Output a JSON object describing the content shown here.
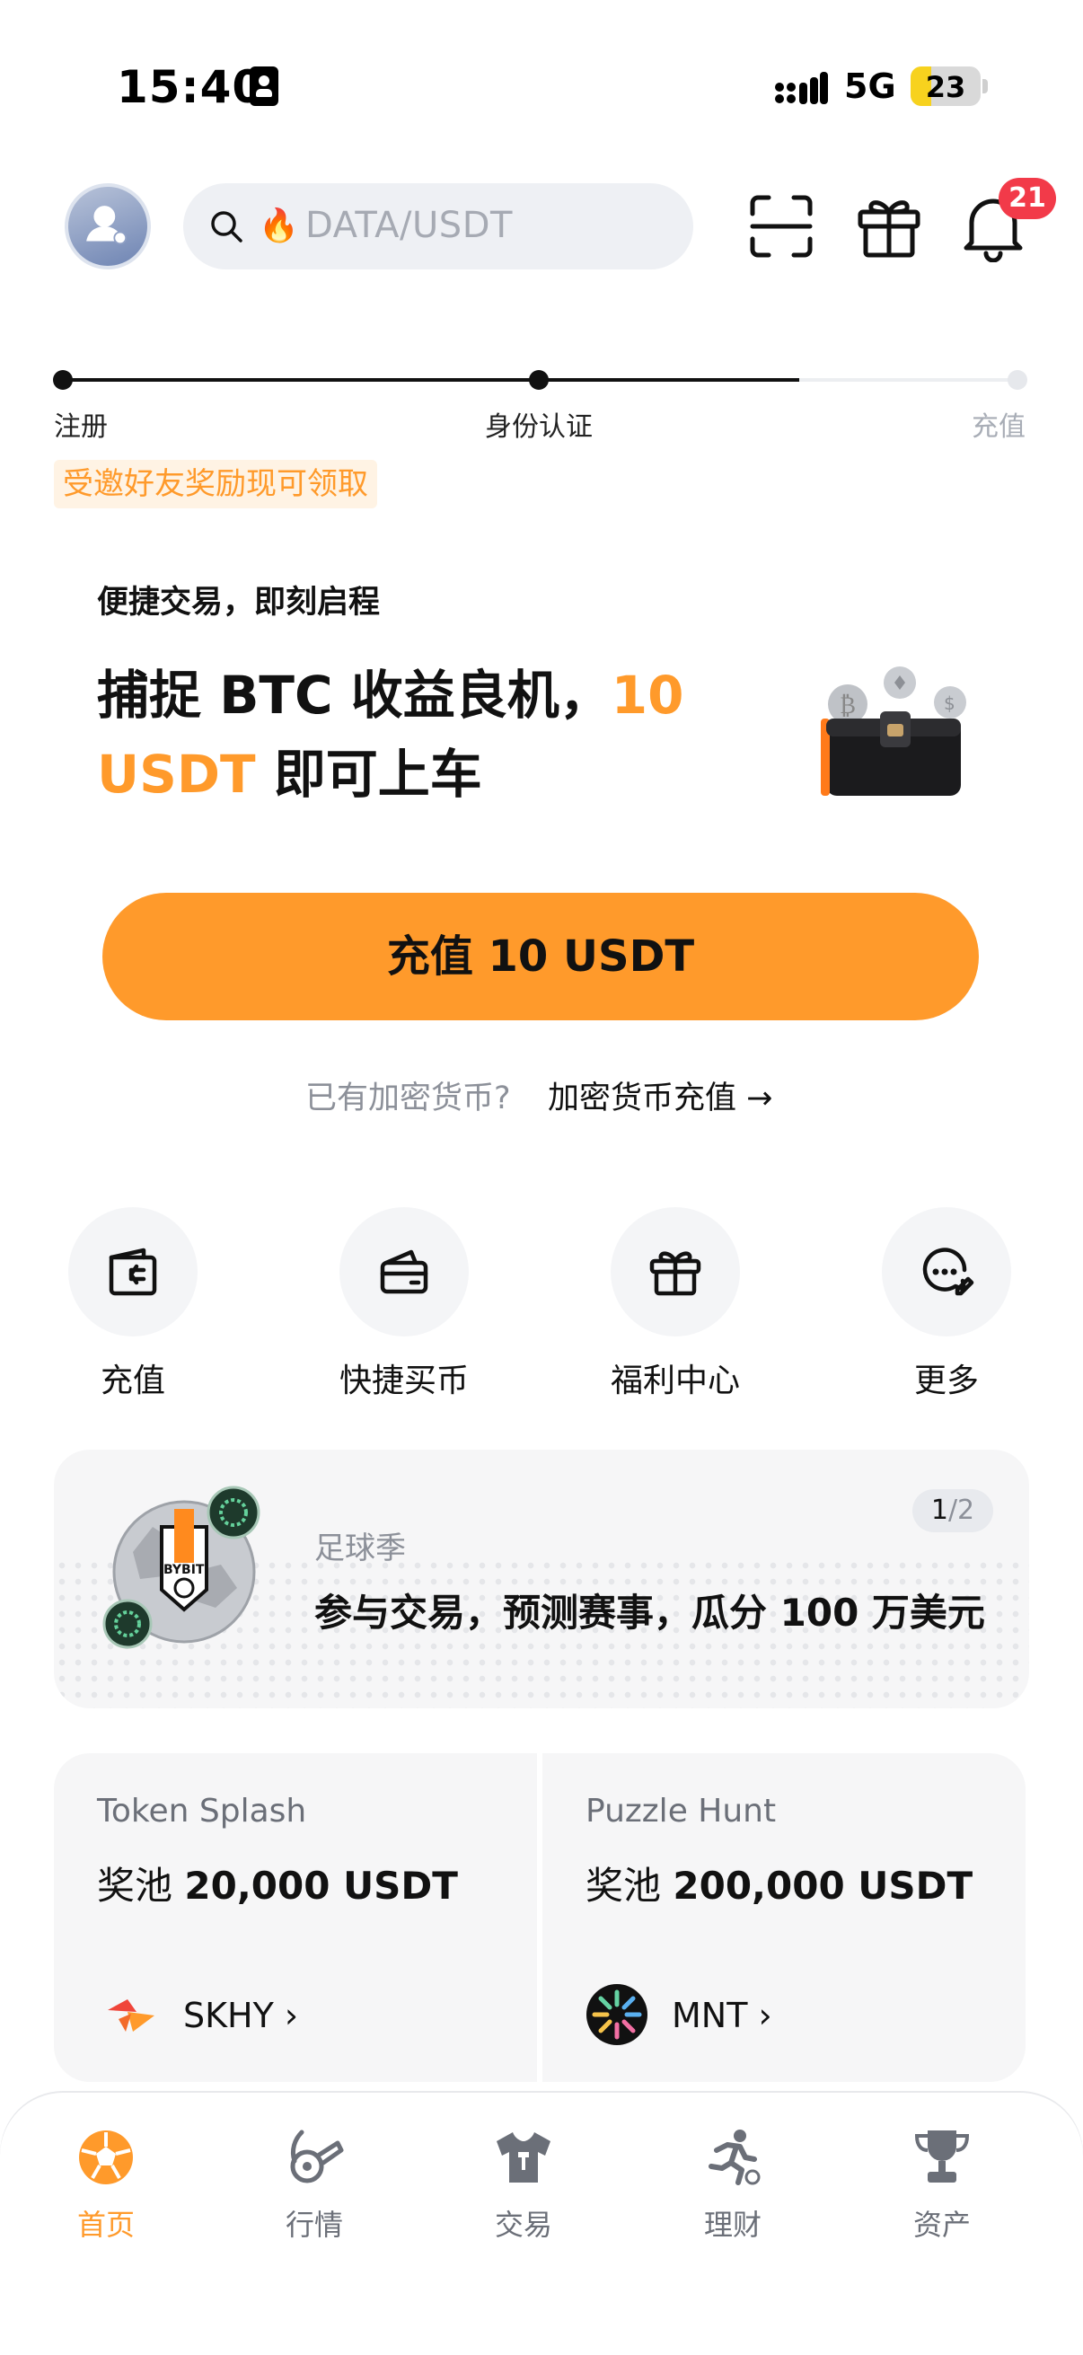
{
  "status_bar": {
    "time": "15:40",
    "network": "5G",
    "battery": "23"
  },
  "header": {
    "search_placeholder": "DATA/USDT",
    "notification_count": "21"
  },
  "progress": {
    "steps": [
      {
        "label": "注册",
        "done": true
      },
      {
        "label": "身份认证",
        "done": true
      },
      {
        "label": "充值",
        "done": false
      }
    ],
    "invite_text": "受邀好友奖励现可领取"
  },
  "promo": {
    "kicker": "便捷交易，即刻启程",
    "headline_part1": "捕捉 BTC 收益良机，",
    "headline_highlight1": "10",
    "headline_highlight2": "USDT",
    "headline_part2": " 即可上车",
    "cta_label": "充值 10 USDT",
    "have_crypto": "已有加密货币?",
    "have_crypto_link": "加密货币充值 →"
  },
  "quick_actions": [
    {
      "label": "充值",
      "icon": "wallet-deposit-icon"
    },
    {
      "label": "快捷买币",
      "icon": "card-icon"
    },
    {
      "label": "福利中心",
      "icon": "gift-icon"
    },
    {
      "label": "更多",
      "icon": "more-chat-icon"
    }
  ],
  "banner": {
    "kicker": "足球季",
    "title": "参与交易，预测赛事，瓜分 100 万美元",
    "page_current": "1",
    "page_total": "/2"
  },
  "cards": [
    {
      "title": "Token Splash",
      "pool_prefix": "奖池",
      "pool_value": "20,000 USDT",
      "token": "SKHY ›"
    },
    {
      "title": "Puzzle Hunt",
      "pool_prefix": "奖池",
      "pool_value": "200,000 USDT",
      "token": "MNT ›"
    }
  ],
  "tabs": [
    {
      "label": "首页",
      "icon": "football-icon",
      "active": true
    },
    {
      "label": "行情",
      "icon": "whistle-icon",
      "active": false
    },
    {
      "label": "交易",
      "icon": "jersey-icon",
      "active": false
    },
    {
      "label": "理财",
      "icon": "runner-icon",
      "active": false
    },
    {
      "label": "资产",
      "icon": "trophy-icon",
      "active": false
    }
  ],
  "colors": {
    "accent": "#ff9a2b",
    "badge": "#f23a49",
    "text": "#111111",
    "muted": "#8c9099"
  }
}
